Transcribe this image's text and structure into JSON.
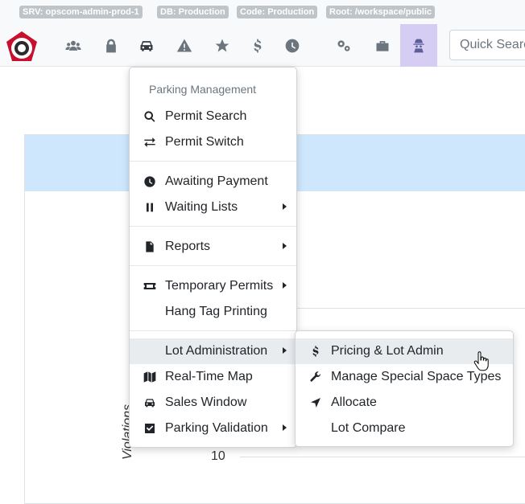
{
  "env_badges": [
    "SRV: opscom-admin-prod-1",
    "DB: Production",
    "Code: Production",
    "Root: /workspace/public"
  ],
  "navbar": {
    "icons": [
      "users-icon",
      "lock-icon",
      "car-icon",
      "warning-icon",
      "star-icon",
      "dollar-icon",
      "clock-icon",
      "cogs-icon",
      "toolbox-icon",
      "user-secret-icon"
    ],
    "search_placeholder": "Quick Search"
  },
  "background": {
    "axis_tick": "10",
    "axis_label": "Violations"
  },
  "menu": {
    "header": "Parking Management",
    "groups": [
      [
        {
          "label": "Permit Search",
          "icon": "search-icon"
        },
        {
          "label": "Permit Switch",
          "icon": "exchange-icon"
        }
      ],
      [
        {
          "label": "Awaiting Payment",
          "icon": "clock-icon"
        },
        {
          "label": "Waiting Lists",
          "icon": "pause-icon",
          "submenu": true
        }
      ],
      [
        {
          "label": "Reports",
          "icon": "file-icon",
          "submenu": true
        }
      ],
      [
        {
          "label": "Temporary Permits",
          "icon": "ticket-icon",
          "submenu": true
        },
        {
          "label": "Hang Tag Printing",
          "icon": ""
        }
      ],
      [
        {
          "label": "Lot Administration",
          "icon": "",
          "submenu": true,
          "hovered": true
        },
        {
          "label": "Real-Time Map",
          "icon": "map-icon"
        },
        {
          "label": "Sales Window",
          "icon": "car-icon"
        },
        {
          "label": "Parking Validation",
          "icon": "check-square-icon",
          "submenu": true
        }
      ]
    ]
  },
  "submenu": {
    "items": [
      {
        "label": "Pricing & Lot Admin",
        "icon": "dollar-icon",
        "hovered": true
      },
      {
        "label": "Manage Special Space Types",
        "icon": "wrench-icon"
      },
      {
        "label": "Allocate",
        "icon": "location-arrow-icon"
      },
      {
        "label": "Lot Compare",
        "icon": ""
      }
    ]
  }
}
